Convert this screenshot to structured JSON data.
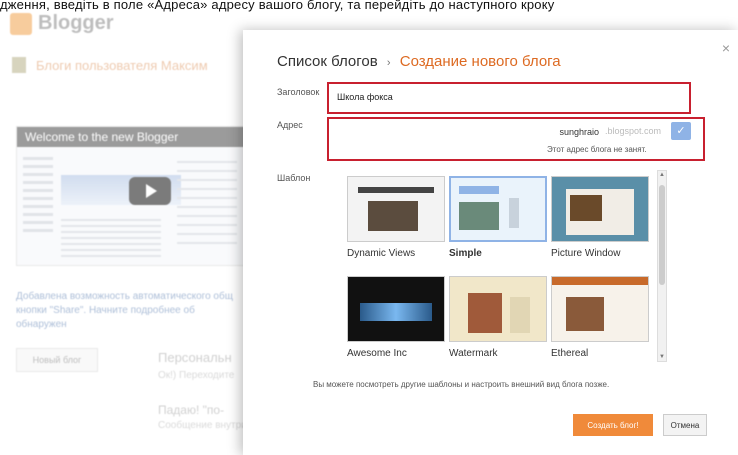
{
  "caption": "дження, введіть в поле «Адреса» адресу вашого блогу, та перейдіть до наступного кроку",
  "background": {
    "logo_text": "Blogger",
    "user_blogs_label": "Блоги пользователя Максим",
    "video_title": "Welcome to the new Blogger",
    "notice_line1": "Добавлена возможность автоматического общ",
    "notice_line2": "кнопки \"Share\". Начните подробнее об обнаружен",
    "new_blog_button": "Новый блог",
    "right_text1": "Персональн",
    "right_text2": "Ок!) Переходите",
    "right_text3": "Падаю! \"по-",
    "right_text4": "Сообщение внутри"
  },
  "dialog": {
    "close_symbol": "×",
    "breadcrumb_parent": "Список блогов",
    "breadcrumb_sep": "›",
    "breadcrumb_current": "Создание нового блога",
    "title_label": "Заголовок",
    "title_value": "Школа фокса",
    "address_label": "Адрес",
    "address_value": "sunghraio",
    "address_suffix": ".blogspot.com",
    "check_symbol": "✓",
    "address_status": "Этот адрес блога не занят.",
    "template_label": "Шаблон",
    "templates": [
      {
        "name": "Dynamic Views"
      },
      {
        "name": "Simple"
      },
      {
        "name": "Picture Window"
      },
      {
        "name": "Awesome Inc"
      },
      {
        "name": "Watermark"
      },
      {
        "name": "Ethereal"
      }
    ],
    "scroll_up": "▲",
    "scroll_down": "▼",
    "note": "Вы можете посмотреть другие шаблоны и настроить внешний вид блога позже.",
    "create_button": "Создать блог!",
    "cancel_button": "Отмена"
  }
}
